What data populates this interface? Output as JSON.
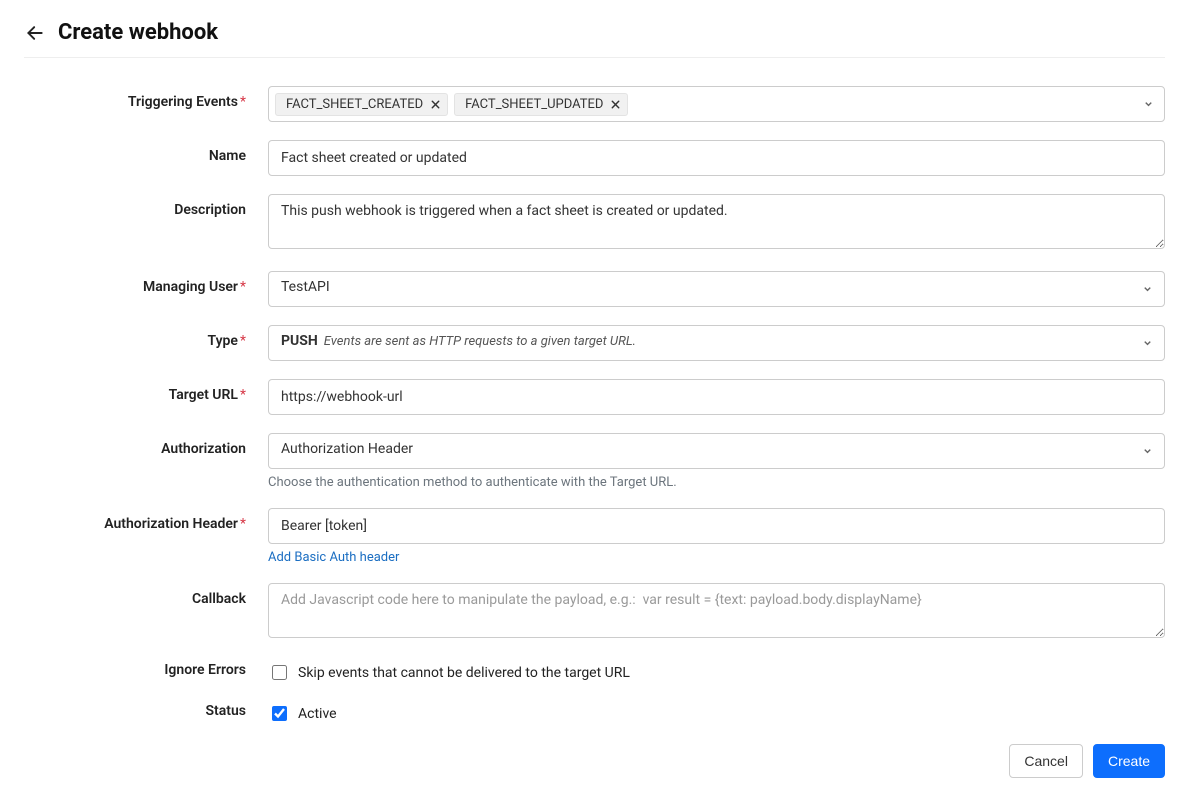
{
  "header": {
    "title": "Create webhook"
  },
  "labels": {
    "triggering_events": "Triggering Events",
    "name": "Name",
    "description": "Description",
    "managing_user": "Managing User",
    "type": "Type",
    "target_url": "Target URL",
    "authorization": "Authorization",
    "authorization_header": "Authorization Header",
    "callback": "Callback",
    "ignore_errors": "Ignore Errors",
    "status": "Status"
  },
  "values": {
    "triggering_events": [
      "FACT_SHEET_CREATED",
      "FACT_SHEET_UPDATED"
    ],
    "name": "Fact sheet created or updated",
    "description": "This push webhook is triggered when a fact sheet is created or updated.",
    "managing_user": "TestAPI",
    "type": {
      "name": "PUSH",
      "desc": "Events are sent as HTTP requests to a given target URL."
    },
    "target_url": "https://webhook-url",
    "authorization": "Authorization Header",
    "authorization_header": "Bearer [token]",
    "callback": "",
    "ignore_errors_checked": false,
    "status_active_checked": true
  },
  "helpers": {
    "authorization": "Choose the authentication method to authenticate with the Target URL.",
    "basic_auth_link": "Add Basic Auth header",
    "ignore_errors_text": "Skip events that cannot be delivered to the target URL",
    "status_active_text": "Active",
    "callback_placeholder": "Add Javascript code here to manipulate the payload, e.g.:  var result = {text: payload.body.displayName}"
  },
  "buttons": {
    "cancel": "Cancel",
    "create": "Create"
  }
}
